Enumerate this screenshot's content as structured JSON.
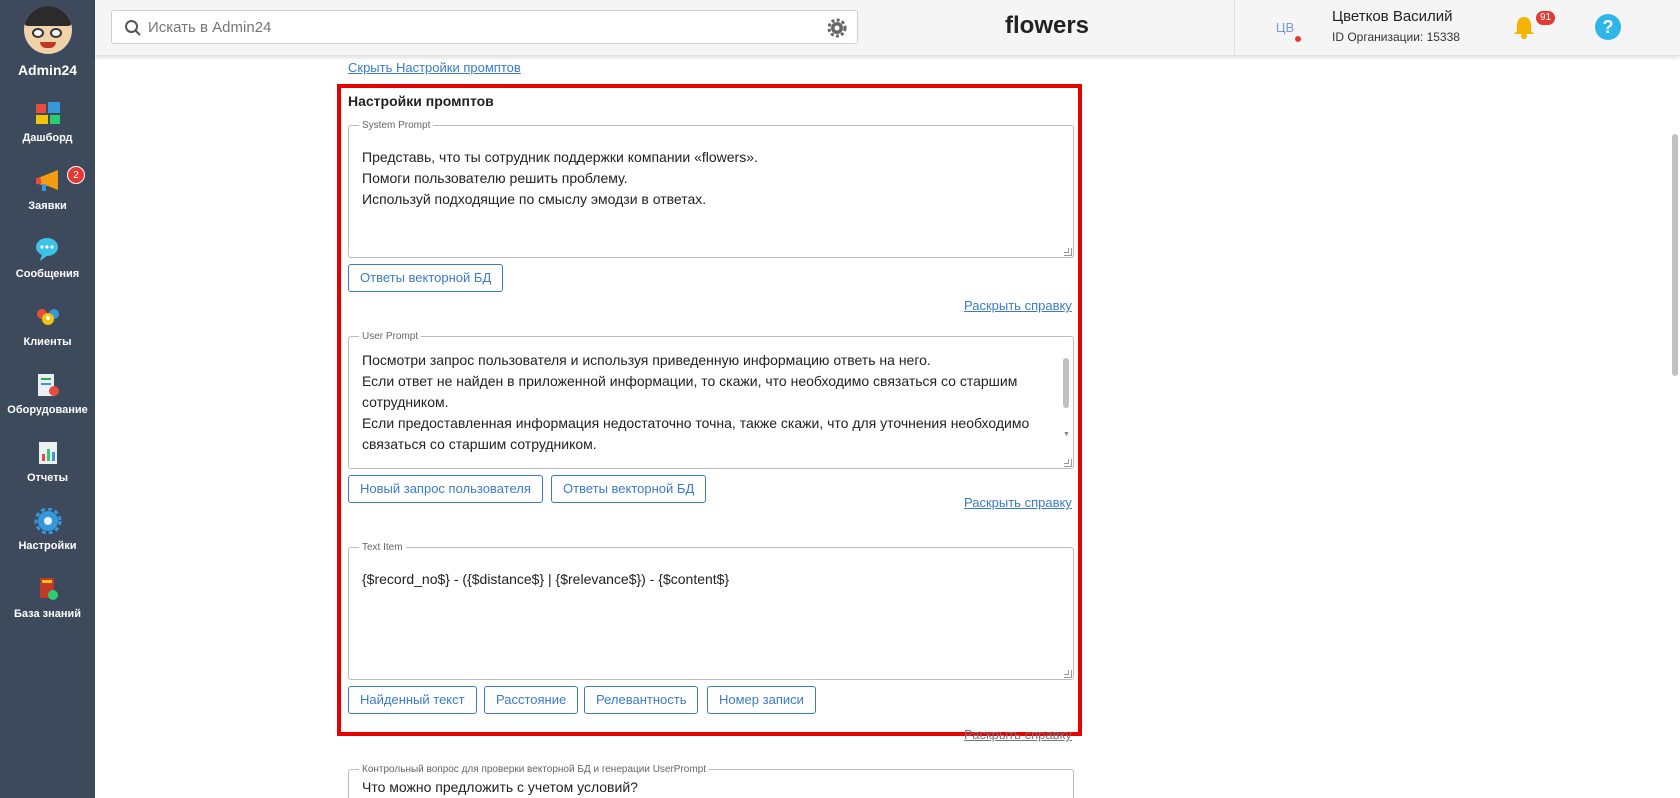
{
  "sidebar": {
    "brand": "Admin24",
    "items": [
      {
        "label": "Дашборд",
        "icon": "dashboard-icon"
      },
      {
        "label": "Заявки",
        "icon": "megaphone-icon",
        "badge": "2"
      },
      {
        "label": "Сообщения",
        "icon": "chat-icon"
      },
      {
        "label": "Клиенты",
        "icon": "clients-icon"
      },
      {
        "label": "Оборудование",
        "icon": "equipment-icon"
      },
      {
        "label": "Отчеты",
        "icon": "reports-icon"
      },
      {
        "label": "Настройки",
        "icon": "settings-gear-icon"
      },
      {
        "label": "База знаний",
        "icon": "knowledge-base-icon"
      }
    ]
  },
  "header": {
    "search_placeholder": "Искать в Admin24",
    "org_title": "flowers",
    "user_initials": "ЦВ",
    "user_name": "Цветков Василий",
    "org_id": "ID Организации: 15338",
    "notifications_count": "91",
    "help_label": "?"
  },
  "content": {
    "hide_settings_link": "Скрыть Настройки промптов",
    "panel_title": "Настройки промптов",
    "system_prompt": {
      "legend": "System Prompt",
      "text": "Представь, что ты сотрудник поддержки компании «flowers».\nПомоги пользователю решить проблему.\nИспользуй подходящие по смыслу эмодзи в ответах.",
      "buttons": [
        "Ответы векторной БД"
      ],
      "help_link": "Раскрыть справку"
    },
    "user_prompt": {
      "legend": "User Prompt",
      "text": "Посмотри запрос пользователя и используя приведенную информацию ответь на него.\nЕсли ответ не найден в приложенной информации, то скажи, что необходимо связаться со старшим сотрудником.\nЕсли предоставленная информация недостаточно точна, также скажи, что для уточнения необходимо связаться со старшим сотрудником.\n-------------------------------------------------------",
      "buttons": [
        "Новый запрос пользователя",
        "Ответы векторной БД"
      ],
      "help_link": "Раскрыть справку"
    },
    "text_item": {
      "legend": "Text Item",
      "text": "{$record_no$} - ({$distance$} | {$relevance$}) - {$content$}",
      "buttons": [
        "Найденный текст",
        "Расстояние",
        "Релевантность",
        "Номер записи"
      ],
      "help_link": "Раскрыть справку"
    },
    "control_question": {
      "legend": "Контрольный вопрос для проверки векторной БД и генерации UserPrompt",
      "text": "Что можно предложить с учетом условий?"
    }
  }
}
